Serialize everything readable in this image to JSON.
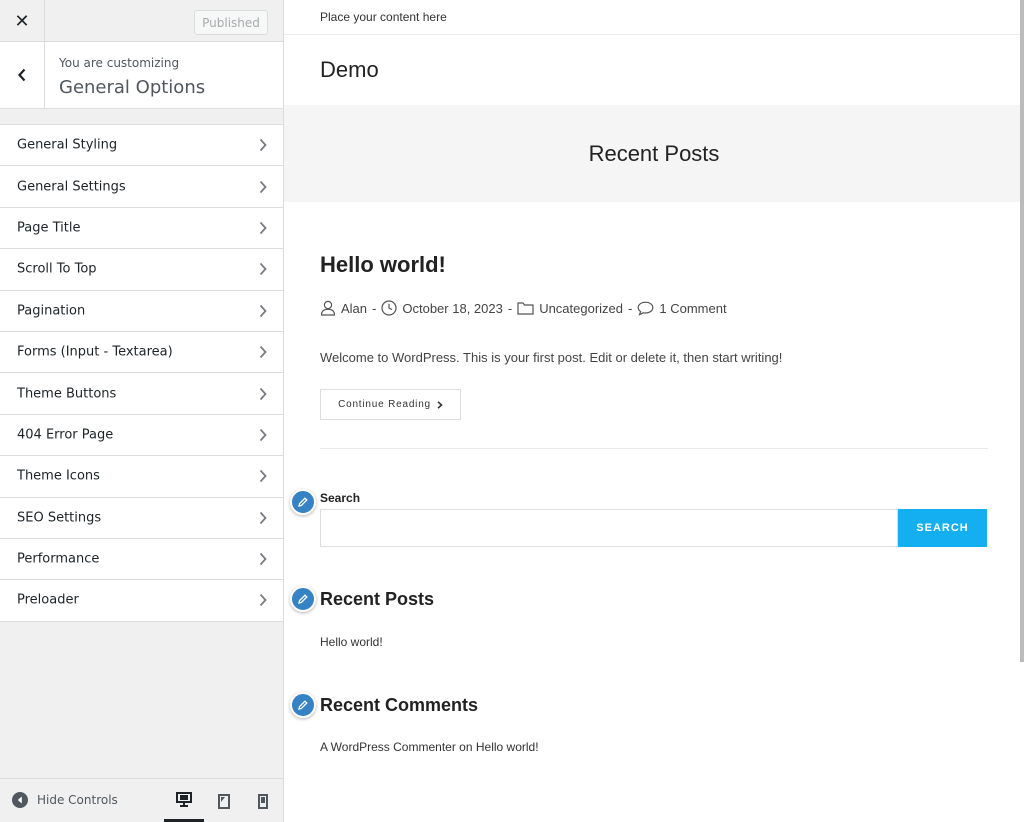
{
  "sidebar": {
    "close_icon": "close-icon",
    "published_label": "Published",
    "customizing_label": "You are customizing",
    "section_title": "General Options",
    "items": [
      {
        "label": "General Styling"
      },
      {
        "label": "General Settings"
      },
      {
        "label": "Page Title"
      },
      {
        "label": "Scroll To Top"
      },
      {
        "label": "Pagination"
      },
      {
        "label": "Forms (Input - Textarea)"
      },
      {
        "label": "Theme Buttons"
      },
      {
        "label": "404 Error Page"
      },
      {
        "label": "Theme Icons"
      },
      {
        "label": "SEO Settings"
      },
      {
        "label": "Performance"
      },
      {
        "label": "Preloader"
      }
    ],
    "footer": {
      "hide_controls_label": "Hide Controls",
      "devices": [
        "desktop",
        "tablet",
        "mobile"
      ],
      "active_device": "desktop"
    }
  },
  "preview": {
    "topbar_text": "Place your content here",
    "site_title": "Demo",
    "page_header_title": "Recent Posts",
    "post": {
      "title": "Hello world!",
      "author": "Alan",
      "date": "October 18, 2023",
      "category": "Uncategorized",
      "comments": "1 Comment",
      "excerpt": "Welcome to WordPress. This is your first post. Edit or delete it, then start writing!",
      "continue_label": "Continue Reading"
    },
    "widgets": {
      "search_title": "Search",
      "search_value": "",
      "search_button": "SEARCH",
      "recent_posts_title": "Recent Posts",
      "recent_posts": [
        "Hello world!"
      ],
      "recent_comments_title": "Recent Comments",
      "comment_author": "A WordPress Commenter",
      "comment_on": "on",
      "comment_post": "Hello world!"
    },
    "accent_color": "#13aff0",
    "shortcut_color": "#3582c4"
  }
}
